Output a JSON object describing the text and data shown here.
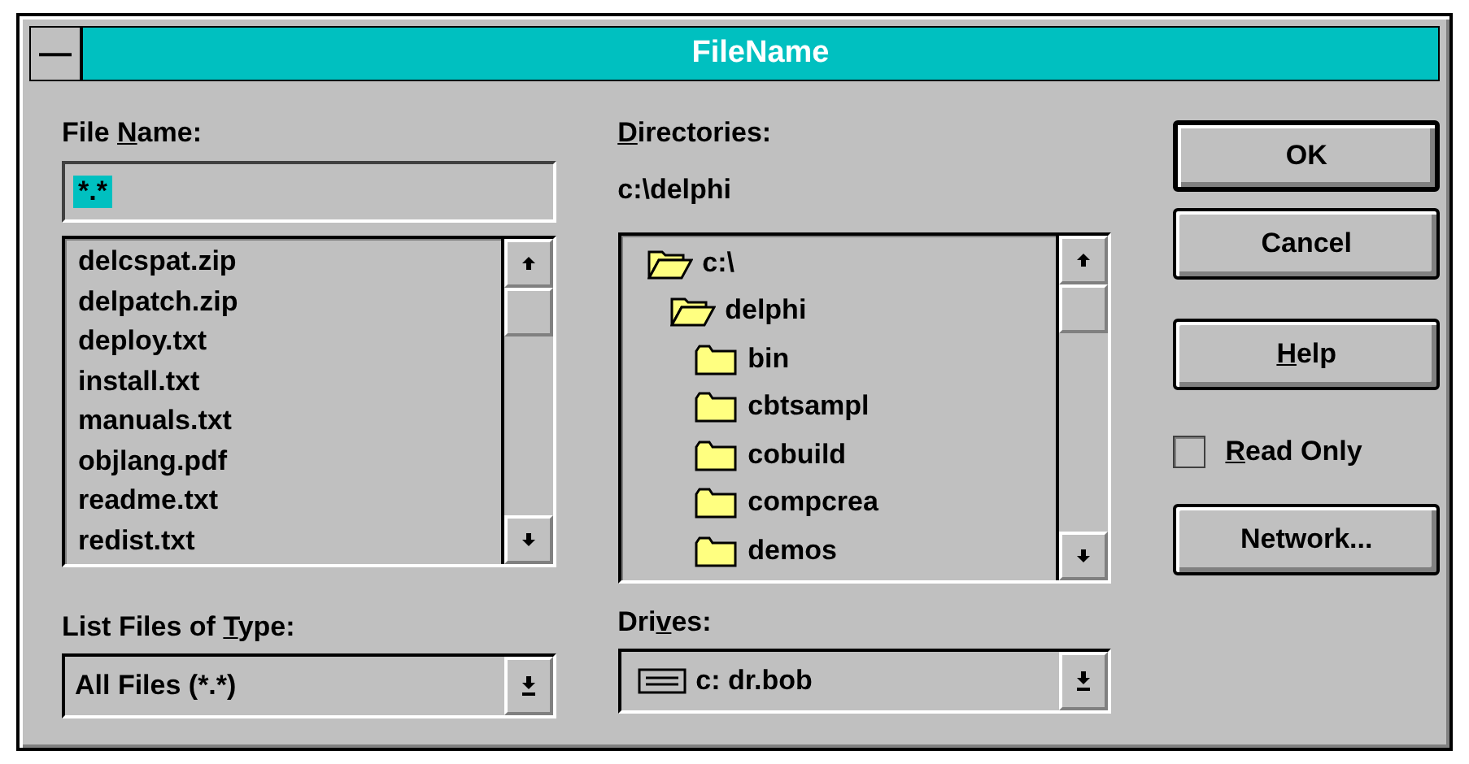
{
  "window": {
    "title": "FileName",
    "menu_glyph": "—"
  },
  "file_name": {
    "label": {
      "before": "File ",
      "key": "N",
      "after": "ame:"
    },
    "value": "*.*",
    "value_selected": true
  },
  "files": [
    "delcspat.zip",
    "delpatch.zip",
    "deploy.txt",
    "install.txt",
    "manuals.txt",
    "objlang.pdf",
    "readme.txt",
    "redist.txt"
  ],
  "file_type": {
    "label": {
      "before": "List Files of ",
      "key": "T",
      "after": "ype:"
    },
    "value": "All Files (*.*)"
  },
  "directories": {
    "label": {
      "key": "D",
      "after": "irectories:"
    },
    "path": "c:\\delphi",
    "tree": [
      {
        "name": "c:\\",
        "expanded": true,
        "children": [
          {
            "name": "delphi",
            "expanded": true,
            "children": [
              {
                "name": "bin",
                "expanded": false
              },
              {
                "name": "cbtsampl",
                "expanded": false
              },
              {
                "name": "cobuild",
                "expanded": false
              },
              {
                "name": "compcrea",
                "expanded": false
              },
              {
                "name": "demos",
                "expanded": false
              }
            ]
          }
        ]
      }
    ]
  },
  "drives": {
    "label": {
      "before": "Dri",
      "key": "v",
      "after": "es:"
    },
    "value": "c: dr.bob"
  },
  "buttons": [
    {
      "label": {
        "after": "OK"
      },
      "default": true
    },
    {
      "label": {
        "after": "Cancel"
      },
      "default": false
    },
    {
      "label": {
        "key": "H",
        "after": "elp"
      },
      "default": false
    },
    {
      "label": {
        "after": "Network..."
      },
      "default": false
    }
  ],
  "read_only": {
    "label": {
      "key": "R",
      "after": "ead Only"
    },
    "checked": false
  }
}
